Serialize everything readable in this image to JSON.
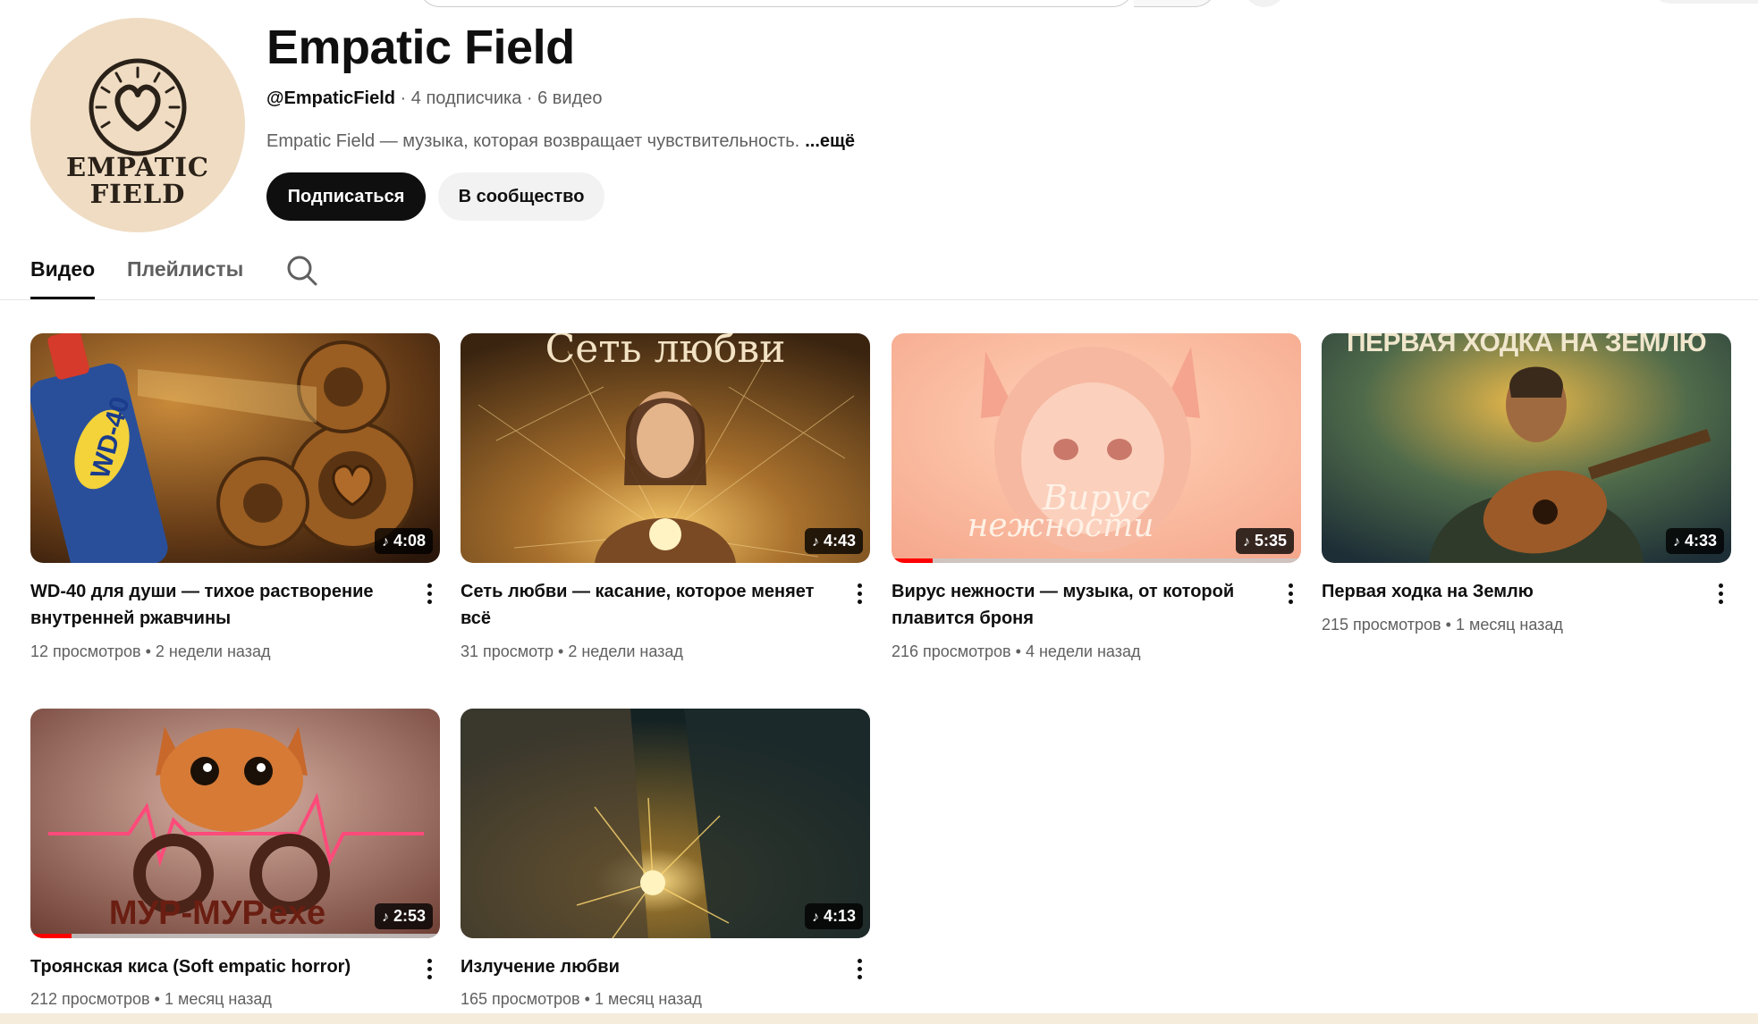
{
  "channel": {
    "name": "Empatic Field",
    "handle": "@EmpaticField",
    "subscribers": "4 подписчика",
    "video_count": "6 видео",
    "meta_separator": " · ",
    "description": "Empatic Field — музыка, которая возвращает чувствительность.",
    "more_label": "...ещё",
    "avatar_text_line1": "EMPATIC",
    "avatar_text_line2": "FIELD",
    "subscribe_label": "Подписаться",
    "community_label": "В сообщество"
  },
  "tabs": [
    {
      "label": "Видео",
      "active": true
    },
    {
      "label": "Плейлисты",
      "active": false
    }
  ],
  "videos": [
    {
      "title": "WD-40 для души — тихое растворение внутренней ржавчины",
      "views": "12 просмотров",
      "age": "2 недели назад",
      "duration": "4:08",
      "thumb_text": "WD-40",
      "watched_fraction": 0
    },
    {
      "title": "Сеть любви — касание, которое меняет всё",
      "views": "31 просмотр",
      "age": "2 недели назад",
      "duration": "4:43",
      "thumb_text": "Сеть любви",
      "watched_fraction": 0
    },
    {
      "title": "Вирус нежности — музыка, от которой плавится броня",
      "views": "216 просмотров",
      "age": "4 недели назад",
      "duration": "5:35",
      "thumb_text_line1": "Вирус",
      "thumb_text_line2": "нежности",
      "watched_fraction": 0.1
    },
    {
      "title": "Первая ходка на Землю",
      "views": "215 просмотров",
      "age": "1 месяц назад",
      "duration": "4:33",
      "thumb_text": "ПЕРВАЯ ХОДКА НА ЗЕМЛЮ",
      "watched_fraction": 0
    },
    {
      "title": "Троянская киса (Soft empatic horror)",
      "views": "212 просмотров",
      "age": "1 месяц назад",
      "duration": "2:53",
      "thumb_text": "МУР-МУР.exe",
      "watched_fraction": 0.1
    },
    {
      "title": "Излучение любви",
      "views": "165 просмотров",
      "age": "1 месяц назад",
      "duration": "4:13",
      "watched_fraction": 0
    }
  ],
  "meta_dot": " • ",
  "icons": {
    "search": "search-icon",
    "more": "more-vert-icon",
    "music_note": "music-note-icon"
  },
  "colors": {
    "accent": "#0f0f0f",
    "secondary_text": "#606060",
    "progress": "#ff0000",
    "avatar_bg": "#efdcc3"
  }
}
